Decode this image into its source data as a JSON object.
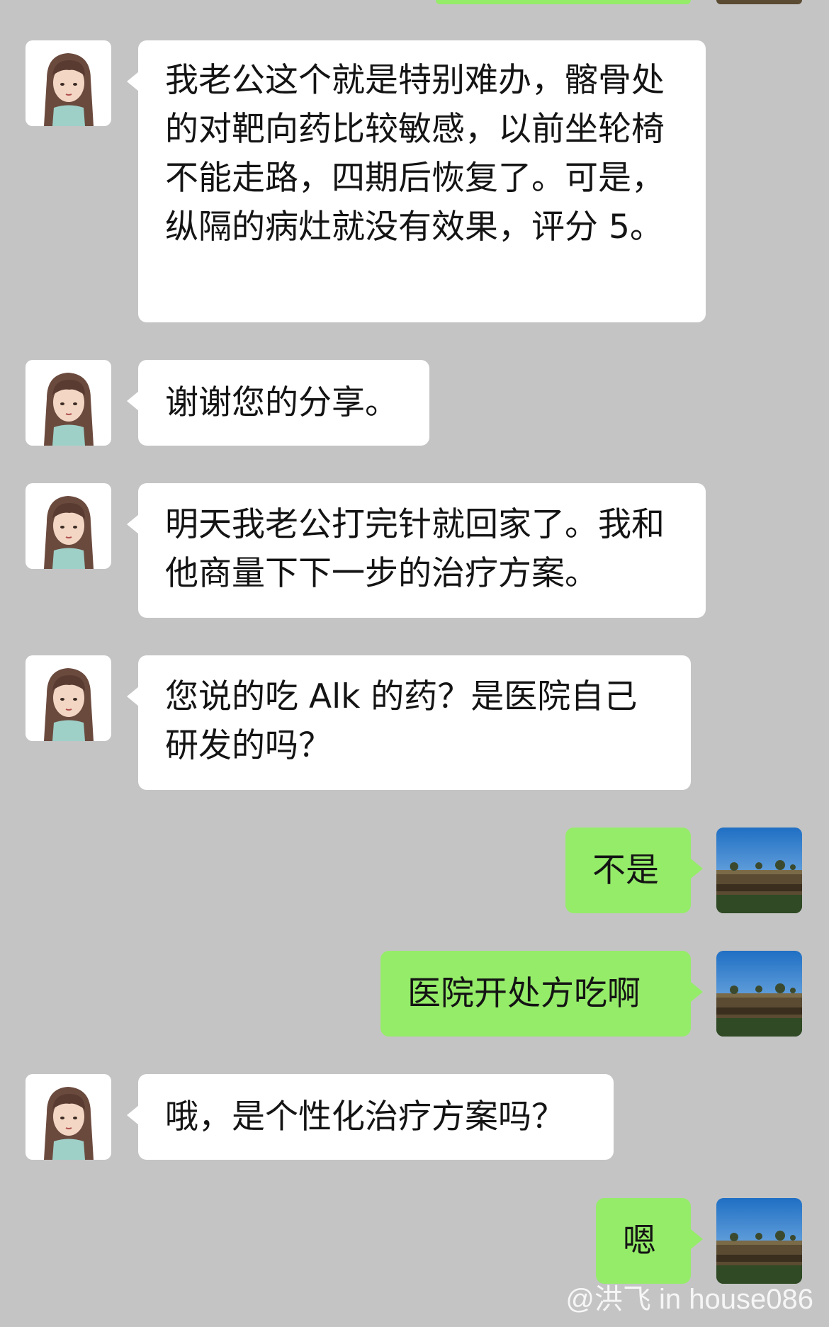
{
  "colors": {
    "background": "#c4c4c4",
    "incoming_bubble": "#ffffff",
    "outgoing_bubble": "#95ec69",
    "text": "#141414"
  },
  "messages": [
    {
      "direction": "incoming",
      "avatar": "girl-avatar-icon",
      "text": "我老公这个就是特别难办，髂骨处的对靶向药比较敏感，以前坐轮椅不能走路，四期后恢复了。可是，纵隔的病灶就没有效果，评分 5。"
    },
    {
      "direction": "incoming",
      "avatar": "girl-avatar-icon",
      "text": "谢谢您的分享。"
    },
    {
      "direction": "incoming",
      "avatar": "girl-avatar-icon",
      "text": "明天我老公打完针就回家了。我和他商量下下一步的治疗方案。"
    },
    {
      "direction": "incoming",
      "avatar": "girl-avatar-icon",
      "text": "您说的吃 Alk 的药？是医院自己研发的吗？"
    },
    {
      "direction": "outgoing",
      "avatar": "landscape-avatar-icon",
      "text": "不是"
    },
    {
      "direction": "outgoing",
      "avatar": "landscape-avatar-icon",
      "text": "医院开处方吃啊"
    },
    {
      "direction": "incoming",
      "avatar": "girl-avatar-icon",
      "text": "哦，是个性化治疗方案吗？"
    },
    {
      "direction": "outgoing",
      "avatar": "landscape-avatar-icon",
      "text": "嗯"
    }
  ],
  "watermark": "@洪飞 in house086"
}
